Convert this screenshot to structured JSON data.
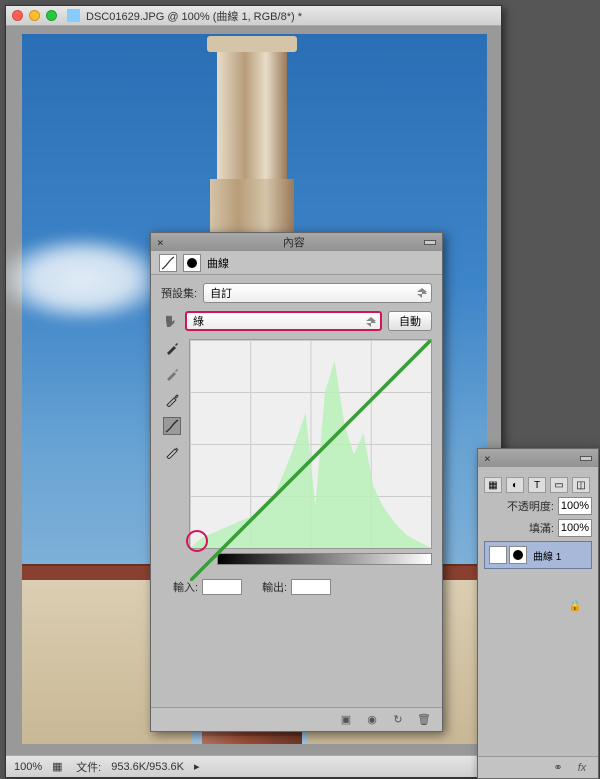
{
  "window": {
    "title": "DSC01629.JPG @ 100% (曲線 1, RGB/8*) *"
  },
  "statusbar": {
    "zoom": "100%",
    "doc_label": "文件:",
    "doc_size": "953.6K/953.6K"
  },
  "curves": {
    "panel_title": "內容",
    "tab_label": "曲線",
    "preset_label": "預設集:",
    "preset_value": "自訂",
    "channel_value": "綠",
    "auto_label": "自動",
    "input_label": "輸入:",
    "output_label": "輸出:"
  },
  "layers": {
    "opacity_label": "不透明度:",
    "opacity_value": "100%",
    "fill_label": "填滿:",
    "fill_value": "100%",
    "layer1_name": "曲線 1"
  }
}
